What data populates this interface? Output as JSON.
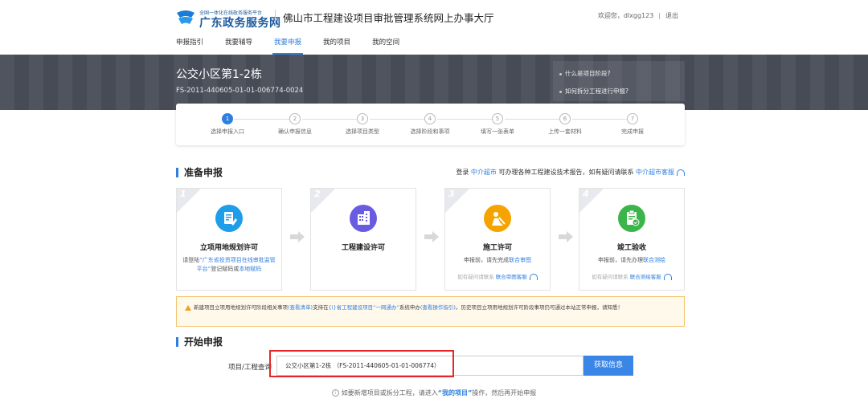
{
  "header": {
    "logo_small": "全国一体化在线政务服务平台",
    "logo_big": "广东政务服务网",
    "system_title": "佛山市工程建设项目审批管理系统网上办事大厅",
    "welcome": "欢迎您，",
    "username": "dlxgg123",
    "logout": "退出"
  },
  "nav": {
    "items": [
      "申报指引",
      "我要辅导",
      "我要申报",
      "我的项目",
      "我的空间"
    ],
    "active_index": 2
  },
  "banner": {
    "project_name": "公交小区第1-2栋",
    "project_code": "FS-2011-440605-01-01-006774-0024",
    "help_links": [
      "什么是项目阶段?",
      "如何拆分工程进行申报?"
    ]
  },
  "steps": [
    {
      "num": "1",
      "label": "选择申报入口",
      "active": true
    },
    {
      "num": "2",
      "label": "确认申报信息",
      "active": false
    },
    {
      "num": "3",
      "label": "选择项目类型",
      "active": false
    },
    {
      "num": "4",
      "label": "选择阶段和事项",
      "active": false
    },
    {
      "num": "5",
      "label": "填写一张表单",
      "active": false
    },
    {
      "num": "6",
      "label": "上传一套材料",
      "active": false
    },
    {
      "num": "7",
      "label": "完成申报",
      "active": false
    }
  ],
  "prepare": {
    "title": "准备申报",
    "right_prefix": "登录",
    "right_link1": "中介超市",
    "right_middle": "可办理各种工程建设技术报告，如有疑问请联系",
    "right_link2": "中介超市客服"
  },
  "cards": [
    {
      "num": "1",
      "title": "立项用地规划许可",
      "desc_pre": "请登陆",
      "desc_link1": "“广东省投资项目在线审批监管平台”",
      "desc_mid": "登记赋码或",
      "desc_link2": "本地赋码",
      "hint_pre": "",
      "hint_link": "",
      "icon": "document-edit-icon",
      "color": "#1e9ee8"
    },
    {
      "num": "2",
      "title": "工程建设许可",
      "desc_pre": "",
      "desc_link1": "",
      "desc_mid": "",
      "desc_link2": "",
      "hint_pre": "",
      "hint_link": "",
      "icon": "building-icon",
      "color": "#6a5ce0"
    },
    {
      "num": "3",
      "title": "施工许可",
      "desc_pre": "申报前，请先完成",
      "desc_link1": "联合审图",
      "desc_mid": "",
      "desc_link2": "",
      "hint_pre": "如有疑问请联系",
      "hint_link": "联合审图客服",
      "icon": "construction-worker-icon",
      "color": "#f5a300"
    },
    {
      "num": "4",
      "title": "竣工验收",
      "desc_pre": "申报前，请先办理",
      "desc_link1": "联合测绘",
      "desc_mid": "",
      "desc_link2": "",
      "hint_pre": "如有疑问请联系",
      "hint_link": "联合测绘客服",
      "icon": "checklist-icon",
      "color": "#3bb54a"
    }
  ],
  "notice": {
    "p1": "新建项目立项用地规划许可阶段相关事项",
    "link1": "(查看清单)",
    "p2": "支持在",
    "link2": "{i}省工程建设项目“一网通办”",
    "p3": "系统申办",
    "link3": "(查看操作指引)",
    "p4": "。历史项目立项用地规划许可阶段事项仍可通过本站正常申报，请知悉！"
  },
  "start": {
    "title": "开始申报",
    "query_label": "项目/工程查询",
    "query_value": "公交小区第1-2栋 （FS-2011-440605-01-01-006774）",
    "button": "获取信息"
  },
  "footer": {
    "tip_pre": "如要新增项目或拆分工程，请进入",
    "tip_link": "“我的项目”",
    "tip_post": "操作，然后再开始申报"
  },
  "colors": {
    "accent": "#2f7fe0",
    "banner": "#4a4e5a",
    "highlight": "#e5262a",
    "notice_border": "#f3c36b"
  }
}
